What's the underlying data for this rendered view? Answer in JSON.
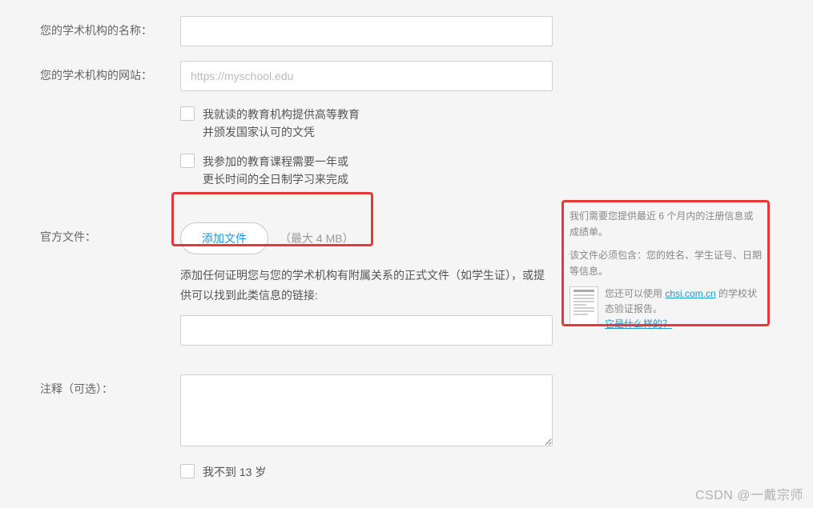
{
  "labels": {
    "institution_name": "您的学术机构的名称：",
    "institution_website": "您的学术机构的网站：",
    "official_document": "官方文件：",
    "notes": "注释（可选）："
  },
  "fields": {
    "website_placeholder": "https://myschool.edu"
  },
  "checkboxes": {
    "higher_ed_line1": "我就读的教育机构提供高等教育",
    "higher_ed_line2": "并颁发国家认可的文凭",
    "course_line1": "我参加的教育课程需要一年或",
    "course_line2": "更长时间的全日制学习来完成",
    "under_13": "我不到 13 岁"
  },
  "file_upload": {
    "button_label": "添加文件",
    "size_hint": "（最大 4 MB）",
    "description": "添加任何证明您与您的学术机构有附属关系的正式文件（如学生证），或提供可以找到此类信息的链接:"
  },
  "info_panel": {
    "requirement1": "我们需要您提供最近 6 个月内的注册信息或成绩单。",
    "requirement2": "该文件必须包含：您的姓名、学生证号、日期等信息。",
    "chsi_prefix": "您还可以使用 ",
    "chsi_link": "chsi.com.cn",
    "chsi_suffix": " 的学校状态验证报告。",
    "what_is_it": "它是什么样的？"
  },
  "watermark": "CSDN @一戴宗师"
}
